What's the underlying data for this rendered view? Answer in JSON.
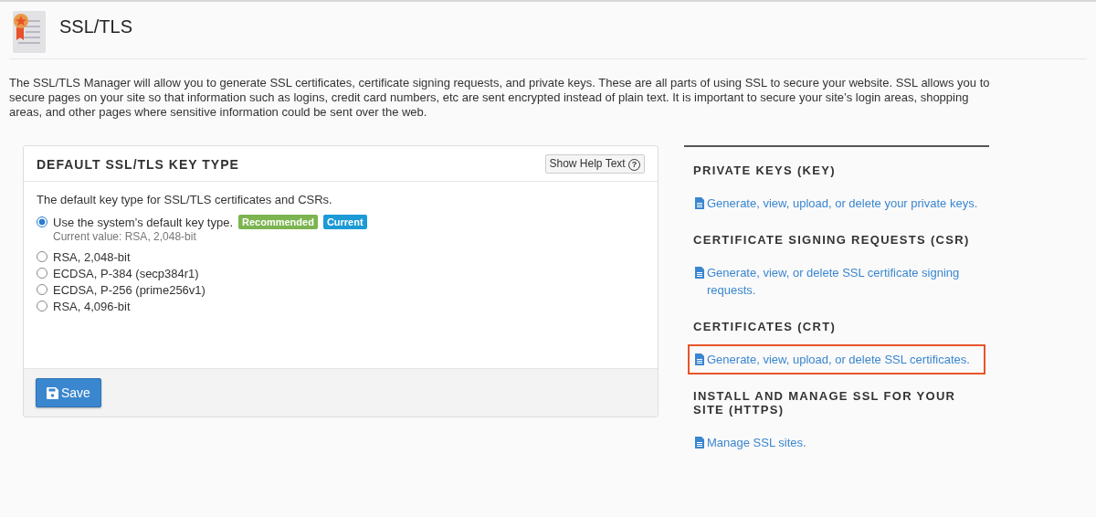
{
  "page": {
    "title": "SSL/TLS",
    "description": "The SSL/TLS Manager will allow you to generate SSL certificates, certificate signing requests, and private keys. These are all parts of using SSL to secure your website. SSL allows you to secure pages on your site so that information such as logins, credit card numbers, etc are sent encrypted instead of plain text. It is important to secure your site’s login areas, shopping areas, and other pages where sensitive information could be sent over the web."
  },
  "key_type_panel": {
    "title": "DEFAULT SSL/TLS KEY TYPE",
    "help_button": "Show Help Text",
    "help_glyph": "?",
    "intro": "The default key type for SSL/TLS certificates and CSRs.",
    "options": [
      {
        "label": "Use the system’s default key type.",
        "selected": true,
        "badges": [
          {
            "text": "Recommended",
            "color": "#7cb550"
          },
          {
            "text": "Current",
            "color": "#1b9ad6"
          }
        ],
        "note": "Current value: RSA, 2,048-bit"
      },
      {
        "label": "RSA, 2,048-bit",
        "selected": false
      },
      {
        "label": "ECDSA, P-384 (secp384r1)",
        "selected": false
      },
      {
        "label": "ECDSA, P-256 (prime256v1)",
        "selected": false
      },
      {
        "label": "RSA, 4,096-bit",
        "selected": false
      }
    ],
    "save_button": "Save"
  },
  "sections": [
    {
      "heading": "PRIVATE KEYS (KEY)",
      "link": "Generate, view, upload, or delete your private keys.",
      "highlighted": false
    },
    {
      "heading": "CERTIFICATE SIGNING REQUESTS (CSR)",
      "link": "Generate, view, or delete SSL certificate signing requests.",
      "highlighted": false
    },
    {
      "heading": "CERTIFICATES (CRT)",
      "link": "Generate, view, upload, or delete SSL certificates.",
      "highlighted": true
    },
    {
      "heading": "INSTALL AND MANAGE SSL FOR YOUR SITE (HTTPS)",
      "link": "Manage SSL sites.",
      "highlighted": false
    }
  ]
}
